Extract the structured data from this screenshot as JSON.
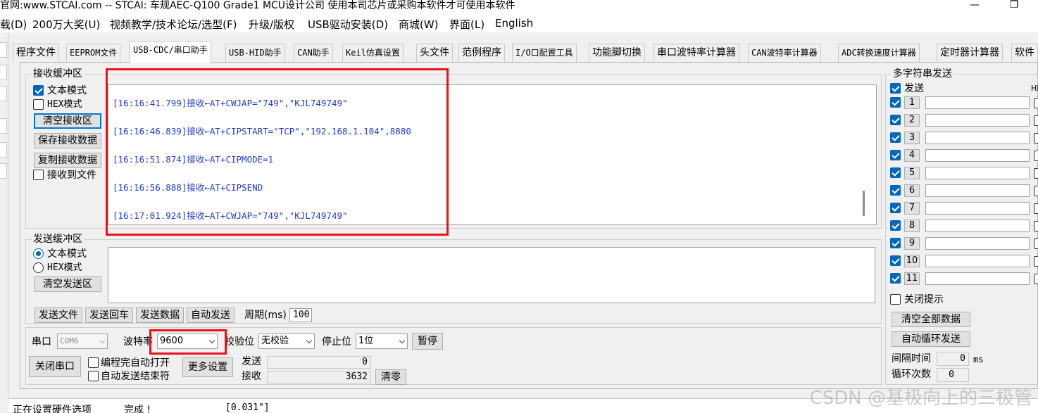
{
  "window": {
    "title": "官网:www.STCAI.com  -- STCAI: 车规AEC-Q100 Grade1 MCU设计公司 使用本司芯片或采购本软件才可使用本软件",
    "minimize_glyph": "—",
    "restore_glyph": "❐"
  },
  "menu": [
    "载(D)",
    "200万大奖(U)",
    "视频教学/技术论坛/选型(F)",
    "升级/版权",
    "USB驱动安装(D)",
    "商城(W)",
    "界面(L)",
    "English"
  ],
  "tabs": [
    "程序文件",
    "EEPROM文件",
    "USB-CDC/串口助手",
    "USB-HID助手",
    "CAN助手",
    "Keil仿真设置",
    "头文件",
    "范例程序",
    "I/O口配置工具",
    "功能脚切换",
    "串口波特率计算器",
    "CAN波特率计算器",
    "ADC转换速度计算器",
    "定时器计算器",
    "软件"
  ],
  "receive": {
    "group_label": "接收缓冲区",
    "text_mode_label": "文本模式",
    "hex_mode_label": "HEX模式",
    "clear_button": "清空接收区",
    "save_button": "保存接收数据",
    "copy_button": "复制接收数据",
    "to_file_label": "接收到文件",
    "lines": [
      "[16:16:41.799]接收←AT+CWJAP=\"749\",\"KJL749749\"",
      "[16:16:46.839]接收←AT+CIPSTART=\"TCP\",\"192.168.1.104\",8880",
      "[16:16:51.874]接收←AT+CIPMODE=1",
      "[16:16:56.888]接收←AT+CIPSEND",
      "[16:17:01.924]接收←AT+CWJAP=\"749\",\"KJL749749\""
    ]
  },
  "send": {
    "group_label": "发送缓冲区",
    "text_mode_label": "文本模式",
    "hex_mode_label": "HEX模式",
    "clear_button": "清空发送区",
    "send_file_button": "发送文件",
    "send_return_button": "发送回车",
    "send_data_button": "发送数据",
    "auto_send_button": "自动发送",
    "period_label": "周期(ms)",
    "period_value": "100"
  },
  "port": {
    "port_label": "串口",
    "port_value": "COM6",
    "baud_label": "波特率",
    "baud_value": "9600",
    "parity_label": "校验位",
    "parity_value": "无校验",
    "stop_label": "停止位",
    "stop_value": "1位",
    "pause_button": "暂停",
    "close_button": "关闭串口",
    "auto_open_label": "编程完自动打开",
    "auto_send_end_label": "自动发送结束符",
    "more_settings_button": "更多设置",
    "sent_label": "发送",
    "sent_value": "0",
    "recv_label": "接收",
    "recv_value": "3632",
    "clear_count_button": "清零"
  },
  "multi": {
    "group_label": "多字符串发送",
    "send_header": "发送",
    "hex_header": "HE",
    "rows": [
      "1",
      "2",
      "3",
      "4",
      "5",
      "6",
      "7",
      "8",
      "9",
      "10",
      "11"
    ],
    "close_hint_label": "关闭提示",
    "clear_all_button": "清空全部数据",
    "auto_loop_button": "自动循环发送",
    "interval_label": "间隔时间",
    "interval_value": "0",
    "interval_unit": "ms",
    "loop_label": "循环次数",
    "loop_value": "0"
  },
  "status": {
    "msg": "正在设置硬件选项",
    "result": "完成 !",
    "time": "[0.031\"]"
  },
  "watermark": "CSDN @基极向上的三极管",
  "colors": {
    "highlight_box": "#e8121a",
    "recv_text": "#1f3bd6",
    "accent": "#0067c0"
  }
}
